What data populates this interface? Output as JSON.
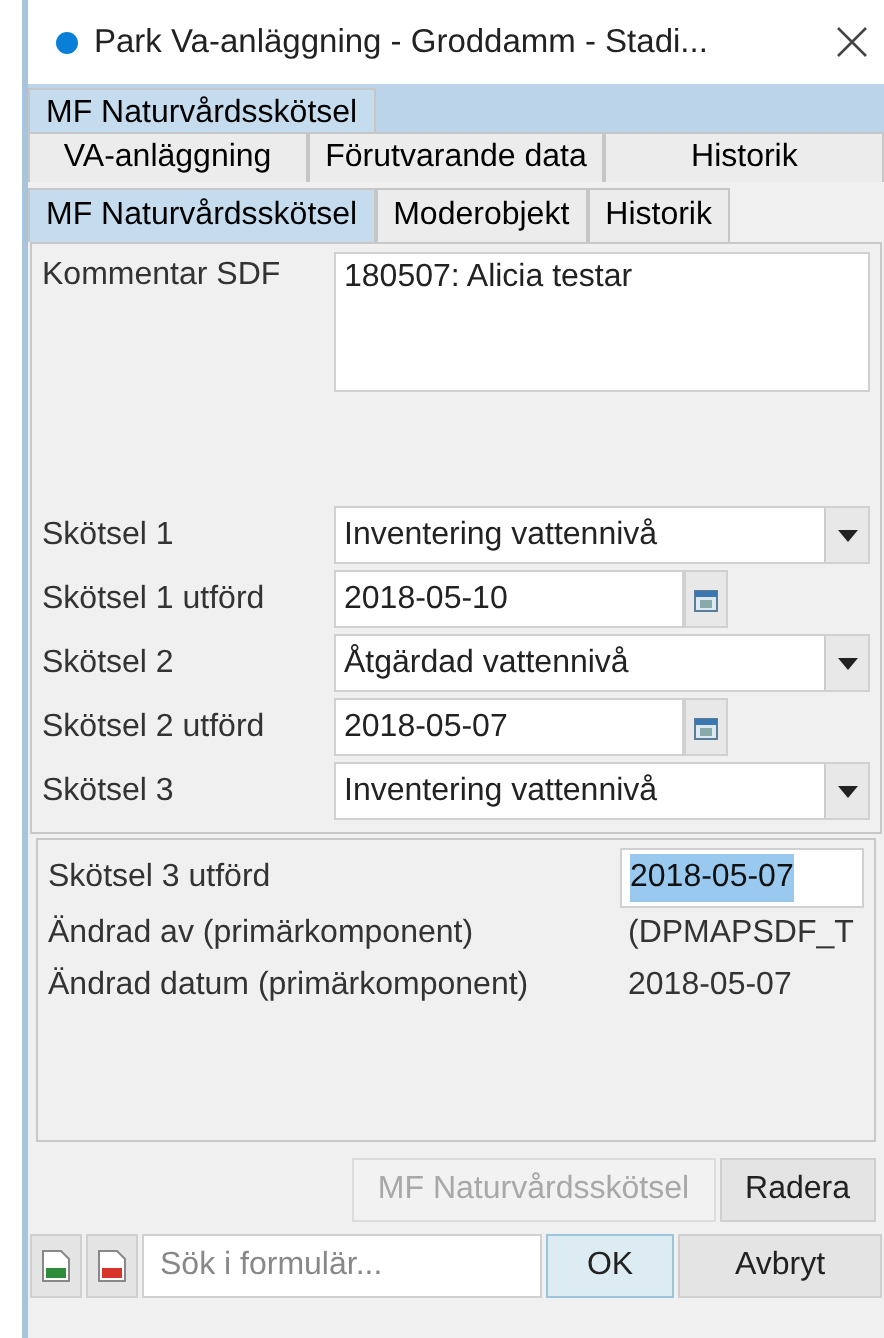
{
  "window": {
    "title": "Park Va-anläggning - Groddamm - Stadi..."
  },
  "top_tabs": [
    {
      "label": "MF Naturvårdsskötsel",
      "selected": true
    }
  ],
  "tabs": [
    {
      "label": "VA-anläggning",
      "selected": false
    },
    {
      "label": "Förutvarande data",
      "selected": false
    },
    {
      "label": "Historik",
      "selected": false
    }
  ],
  "sub_tabs": [
    {
      "label": "MF Naturvårdsskötsel",
      "selected": true
    },
    {
      "label": "Moderobjekt",
      "selected": false
    },
    {
      "label": "Historik",
      "selected": false
    }
  ],
  "fields": [
    {
      "kind": "textarea",
      "label": "Kommentar SDF",
      "value": "180507: Alicia testar"
    },
    {
      "kind": "select",
      "label": "Skötsel 1",
      "value": "Inventering vattennivå"
    },
    {
      "kind": "date",
      "label": "Skötsel 1 utförd",
      "value": "2018-05-10"
    },
    {
      "kind": "select",
      "label": "Skötsel 2",
      "value": "Åtgärdad vattennivå"
    },
    {
      "kind": "date",
      "label": "Skötsel 2 utförd",
      "value": "2018-05-07"
    },
    {
      "kind": "select",
      "label": "Skötsel 3",
      "value": "Inventering vattennivå"
    }
  ],
  "info_fields": [
    {
      "kind": "input",
      "label": "Skötsel 3 utförd",
      "value": "2018-05-07",
      "selected": true
    },
    {
      "kind": "text",
      "label": "Ändrad av (primärkomponent)",
      "value": "(DPMAPSDF_T"
    },
    {
      "kind": "text",
      "label": "Ändrad datum (primärkomponent)",
      "value": "2018-05-07"
    }
  ],
  "actions": [
    {
      "label": "MF Naturvårdsskötsel",
      "disabled": true
    },
    {
      "label": "Radera",
      "disabled": false
    }
  ],
  "footer": {
    "search": {
      "placeholder": "Sök i formulär..."
    },
    "buttons": [
      {
        "label": "OK",
        "focused": true
      },
      {
        "label": "Avbryt",
        "focused": false
      }
    ]
  }
}
